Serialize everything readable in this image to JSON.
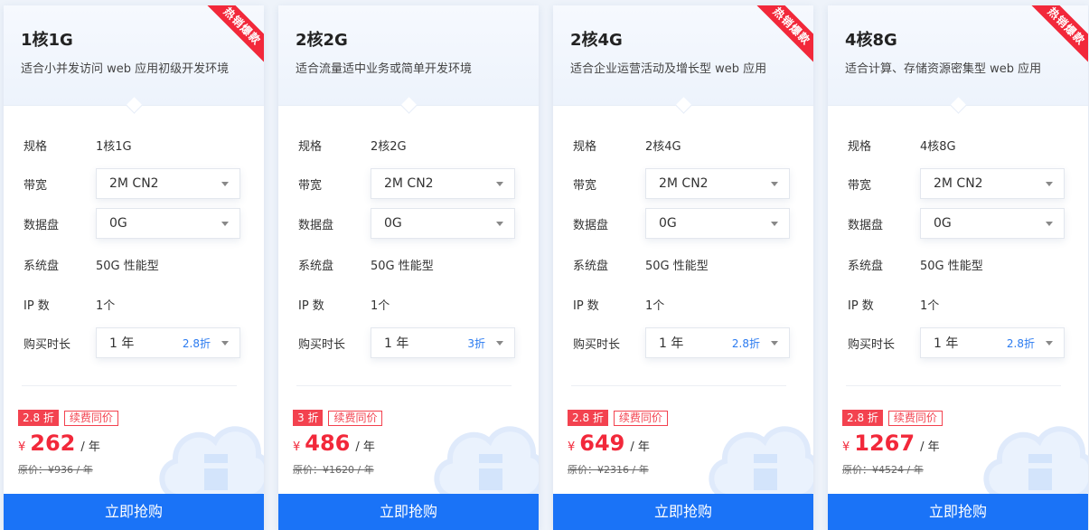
{
  "labels": {
    "spec": "规格",
    "bandwidth": "带宽",
    "data_disk": "数据盘",
    "system_disk": "系统盘",
    "ip_count": "IP 数",
    "purchase_duration": "购买时长"
  },
  "cards": [
    {
      "title": "1核1G",
      "desc": "适合小并发访问 web 应用初级开发环境",
      "ribbon": "热销爆款",
      "spec": "1核1G",
      "bandwidth": "2M CN2",
      "data_disk": "0G",
      "system_disk": "50G 性能型",
      "ip_count": "1个",
      "duration": "1 年",
      "duration_discount": "2.8折",
      "discount_badge": "2.8 折",
      "renew_badge": "续费同价",
      "currency": "¥",
      "price": "262",
      "price_unit": "/ 年",
      "original_price": "原价：¥936 / 年",
      "buy_label": "立即抢购"
    },
    {
      "title": "2核2G",
      "desc": "适合流量适中业务或简单开发环境",
      "ribbon": "",
      "spec": "2核2G",
      "bandwidth": "2M CN2",
      "data_disk": "0G",
      "system_disk": "50G 性能型",
      "ip_count": "1个",
      "duration": "1 年",
      "duration_discount": "3折",
      "discount_badge": "3 折",
      "renew_badge": "续费同价",
      "currency": "¥",
      "price": "486",
      "price_unit": "/ 年",
      "original_price": "原价：¥1620 / 年",
      "buy_label": "立即抢购"
    },
    {
      "title": "2核4G",
      "desc": "适合企业运营活动及增长型 web 应用",
      "ribbon": "热销爆款",
      "spec": "2核4G",
      "bandwidth": "2M CN2",
      "data_disk": "0G",
      "system_disk": "50G 性能型",
      "ip_count": "1个",
      "duration": "1 年",
      "duration_discount": "2.8折",
      "discount_badge": "2.8 折",
      "renew_badge": "续费同价",
      "currency": "¥",
      "price": "649",
      "price_unit": "/ 年",
      "original_price": "原价：¥2316 / 年",
      "buy_label": "立即抢购"
    },
    {
      "title": "4核8G",
      "desc": "适合计算、存储资源密集型 web 应用",
      "ribbon": "热销爆款",
      "spec": "4核8G",
      "bandwidth": "2M CN2",
      "data_disk": "0G",
      "system_disk": "50G 性能型",
      "ip_count": "1个",
      "duration": "1 年",
      "duration_discount": "2.8折",
      "discount_badge": "2.8 折",
      "renew_badge": "续费同价",
      "currency": "¥",
      "price": "1267",
      "price_unit": "/ 年",
      "original_price": "原价：¥4524 / 年",
      "buy_label": "立即抢购"
    }
  ],
  "colors": {
    "accent": "#1a73f7",
    "price_red": "#f2283a",
    "ribbon_red": "#f2283a"
  },
  "icons": {
    "select_caret": "chevron-down-icon",
    "background_cloud": "cloud-icon"
  }
}
